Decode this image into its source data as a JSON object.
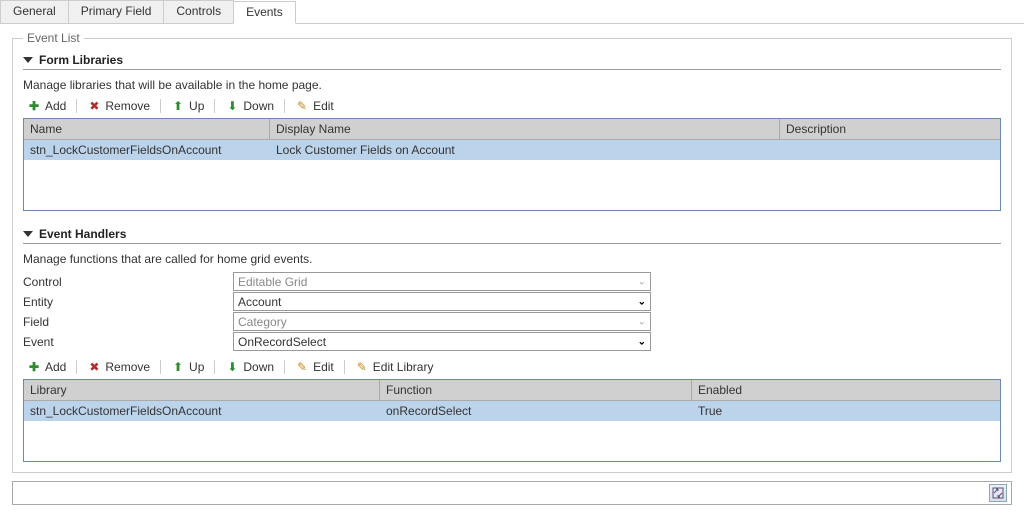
{
  "tabs": {
    "general": "General",
    "primary_field": "Primary Field",
    "controls": "Controls",
    "events": "Events"
  },
  "fieldset_legend": "Event List",
  "form_libraries": {
    "title": "Form Libraries",
    "description": "Manage libraries that will be available in the home page.",
    "toolbar": {
      "add": "Add",
      "remove": "Remove",
      "up": "Up",
      "down": "Down",
      "edit": "Edit"
    },
    "columns": {
      "name": "Name",
      "display_name": "Display Name",
      "description": "Description"
    },
    "rows": [
      {
        "name": "stn_LockCustomerFieldsOnAccount",
        "display_name": "Lock Customer Fields on Account",
        "description": ""
      }
    ]
  },
  "event_handlers": {
    "title": "Event Handlers",
    "description": "Manage functions that are called for home grid events.",
    "form": {
      "control_label": "Control",
      "control_value": "Editable Grid",
      "entity_label": "Entity",
      "entity_value": "Account",
      "field_label": "Field",
      "field_value": "Category",
      "event_label": "Event",
      "event_value": "OnRecordSelect"
    },
    "toolbar": {
      "add": "Add",
      "remove": "Remove",
      "up": "Up",
      "down": "Down",
      "edit": "Edit",
      "edit_library": "Edit Library"
    },
    "columns": {
      "library": "Library",
      "function": "Function",
      "enabled": "Enabled"
    },
    "rows": [
      {
        "library": "stn_LockCustomerFieldsOnAccount",
        "function": "onRecordSelect",
        "enabled": "True"
      }
    ]
  }
}
